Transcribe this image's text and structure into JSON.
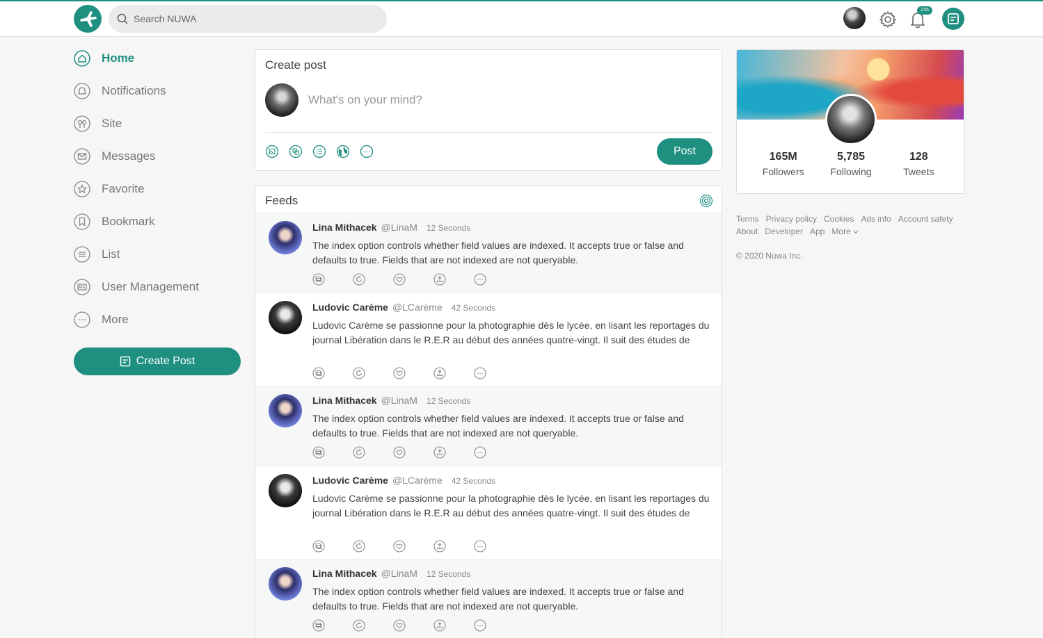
{
  "search": {
    "placeholder": "Search NUWA"
  },
  "notifications": {
    "badge": "235"
  },
  "sidebar": {
    "items": [
      {
        "label": "Home",
        "icon": "home-icon"
      },
      {
        "label": "Notifications",
        "icon": "bell-icon"
      },
      {
        "label": "Site",
        "icon": "site-icon"
      },
      {
        "label": "Messages",
        "icon": "mail-icon"
      },
      {
        "label": "Favorite",
        "icon": "star-icon"
      },
      {
        "label": "Bookmark",
        "icon": "bookmark-icon"
      },
      {
        "label": "List",
        "icon": "list-icon"
      },
      {
        "label": "User Management",
        "icon": "id-card-icon"
      },
      {
        "label": "More",
        "icon": "more-icon"
      }
    ],
    "create_post_label": "Create Post"
  },
  "create_post": {
    "title": "Create post",
    "placeholder": "What's on your mind?",
    "post_label": "Post",
    "tools": [
      "image-icon",
      "gallery-icon",
      "poll-icon",
      "globe-icon",
      "more-icon"
    ]
  },
  "feeds": {
    "title": "Feeds",
    "items": [
      {
        "name": "Lina Mithacek",
        "handle": "@LinaM",
        "time": "12 Seconds",
        "text": "The index option controls whether field values are indexed. It accepts true or false and defaults to true. Fields that are not indexed are not queryable."
      },
      {
        "name": "Ludovic Carème",
        "handle": "@LCarème",
        "time": "42 Seconds",
        "text": "Ludovic Carème se passionne pour la photographie dès le lycée, en lisant les reportages du journal Libération dans le R.E.R au début des années quatre-vingt. Il suit des études de"
      },
      {
        "name": "Lina Mithacek",
        "handle": "@LinaM",
        "time": "12 Seconds",
        "text": "The index option controls whether field values are indexed. It accepts true or false and defaults to true. Fields that are not indexed are not queryable."
      },
      {
        "name": "Ludovic Carème",
        "handle": "@LCarème",
        "time": "42 Seconds",
        "text": "Ludovic Carème se passionne pour la photographie dès le lycée, en lisant les reportages du journal Libération dans le R.E.R au début des années quatre-vingt. Il suit des études de"
      },
      {
        "name": "Lina Mithacek",
        "handle": "@LinaM",
        "time": "12 Seconds",
        "text": "The index option controls whether field values are indexed. It accepts true or false and defaults to true. Fields that are not indexed are not queryable."
      }
    ],
    "actions": [
      "comment-icon",
      "retweet-icon",
      "heart-icon",
      "share-icon",
      "more-icon"
    ]
  },
  "profile": {
    "stats": [
      {
        "value": "165M",
        "label": "Followers"
      },
      {
        "value": "5,785",
        "label": "Following"
      },
      {
        "value": "128",
        "label": "Tweets"
      }
    ]
  },
  "footer": {
    "row1": [
      "Terms",
      "Privacy policy",
      "Cookies",
      "Ads info",
      "Account safety"
    ],
    "row2": [
      "About",
      "Developer",
      "App",
      "More"
    ],
    "copyright": "© 2020 Nuwa Inc."
  },
  "colors": {
    "accent": "#1f8f80",
    "text": "#333333",
    "muted": "#888888"
  }
}
